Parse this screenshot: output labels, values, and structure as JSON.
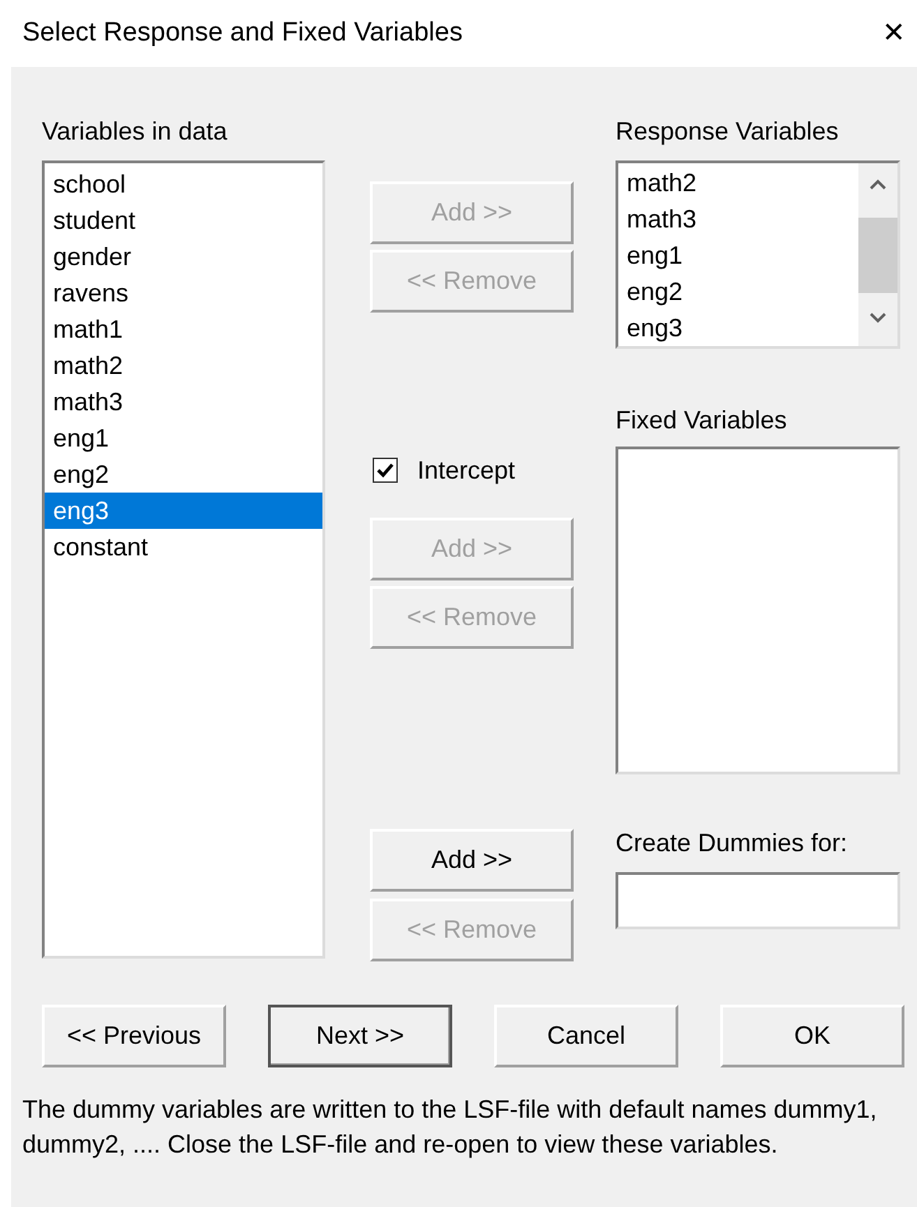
{
  "window": {
    "title": "Select Response and Fixed Variables",
    "close": "✕"
  },
  "variables_in_data": {
    "label": "Variables in data",
    "items": [
      {
        "text": "school",
        "selected": false
      },
      {
        "text": "student",
        "selected": false
      },
      {
        "text": "gender",
        "selected": false
      },
      {
        "text": "ravens",
        "selected": false
      },
      {
        "text": "math1",
        "selected": false
      },
      {
        "text": "math2",
        "selected": false
      },
      {
        "text": "math3",
        "selected": false
      },
      {
        "text": "eng1",
        "selected": false
      },
      {
        "text": "eng2",
        "selected": false
      },
      {
        "text": "eng3",
        "selected": true
      },
      {
        "text": "constant",
        "selected": false
      }
    ]
  },
  "response_buttons": [
    {
      "label": "Add >>",
      "disabled": true
    },
    {
      "label": "<< Remove",
      "disabled": true
    }
  ],
  "intercept": {
    "label": "Intercept",
    "checked": true
  },
  "fixed_buttons": [
    {
      "label": "Add >>",
      "disabled": true
    },
    {
      "label": "<< Remove",
      "disabled": true
    }
  ],
  "dummy_buttons": [
    {
      "label": "Add >>",
      "disabled": false
    },
    {
      "label": "<< Remove",
      "disabled": true
    }
  ],
  "response_variables": {
    "label": "Response Variables",
    "items": [
      {
        "text": "math2",
        "selected": false
      },
      {
        "text": "math3",
        "selected": false
      },
      {
        "text": "eng1",
        "selected": false
      },
      {
        "text": "eng2",
        "selected": false
      },
      {
        "text": "eng3",
        "selected": false
      }
    ]
  },
  "fixed_variables": {
    "label": "Fixed Variables"
  },
  "create_dummies": {
    "label": "Create Dummies for:"
  },
  "footer_buttons": [
    {
      "label": "<< Previous",
      "default": false
    },
    {
      "label": "Next >>",
      "default": true
    },
    {
      "label": "Cancel",
      "default": false
    },
    {
      "label": "OK",
      "default": false
    }
  ],
  "note": "The dummy variables are written to the LSF-file with default names dummy1, dummy2, .... Close the LSF-file and re-open to view these variables."
}
